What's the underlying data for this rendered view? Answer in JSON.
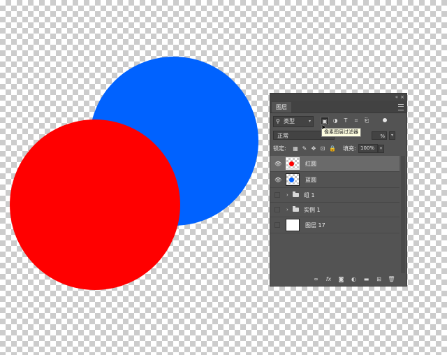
{
  "canvas": {
    "blue_circle_color": "#0062ff",
    "red_circle_color": "#ff0000"
  },
  "panel": {
    "tab_label": "图层",
    "collapse_glyph": "«",
    "close_glyph": "×",
    "filter": {
      "kind_label": "类型",
      "tooltip": "像素图层过滤器"
    },
    "blend_mode": "正常",
    "opacity_value": "%",
    "lock_label": "锁定:",
    "fill_label": "填充:",
    "fill_value": "100%",
    "layers": [
      {
        "name": "红圆",
        "type": "shape",
        "visible": true,
        "selected": true,
        "dot_color": "#ff0000"
      },
      {
        "name": "蓝圆",
        "type": "shape",
        "visible": true,
        "selected": false,
        "dot_color": "#0062ff"
      },
      {
        "name": "组 1",
        "type": "group",
        "visible": false,
        "selected": false
      },
      {
        "name": "实例 1",
        "type": "group",
        "visible": false,
        "selected": false
      },
      {
        "name": "图层 17",
        "type": "pixel",
        "visible": false,
        "selected": false
      }
    ]
  }
}
